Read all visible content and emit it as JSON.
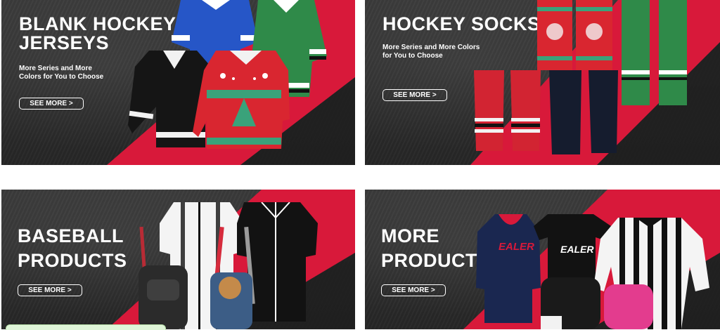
{
  "banners": {
    "jerseys": {
      "title": "BLANK HOCKEY\nJERSEYS",
      "subtitle": "More Series and More\nColors for You to Choose",
      "button": "SEE MORE  >"
    },
    "socks": {
      "title": "HOCKEY SOCKS",
      "subtitle": "More Series and More Colors\nfor You to Choose",
      "button": "SEE MORE  >"
    },
    "baseball": {
      "title": "BASEBALL\nPRODUCTS",
      "button": "SEE MORE  >"
    },
    "more": {
      "title": "MORE\nPRODUCTS",
      "button": "SEE MORE  >"
    }
  },
  "product_prints": {
    "hoodie": "EALER",
    "tshirt": "EALER"
  },
  "colors": {
    "red": "#d8193a",
    "dark": "#2a2a2a",
    "green": "#2f8a49",
    "blue": "#2656c7"
  }
}
